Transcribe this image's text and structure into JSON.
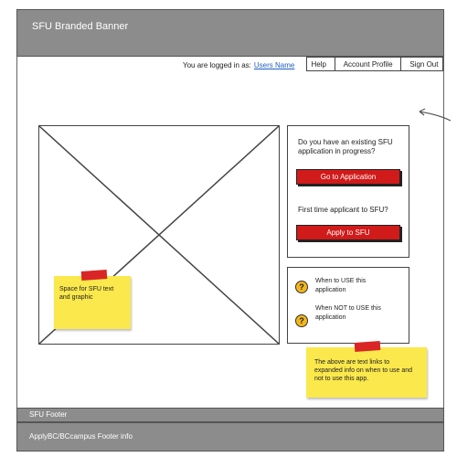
{
  "banner": {
    "title": "SFU Branded Banner"
  },
  "user": {
    "logged_in_label": "You are logged in as:",
    "name": "Users Name"
  },
  "topnav": {
    "items": [
      "Help",
      "Account Profile",
      "Sign Out"
    ]
  },
  "placeholder_note": "Space for SFU text and graphic",
  "existing_app": {
    "question": "Do you have an existing SFU application in progress?",
    "button": "Go to Application"
  },
  "new_app": {
    "question": "First time applicant to SFU?",
    "button": "Apply to SFU"
  },
  "help_links": [
    {
      "icon": "question-icon",
      "text": "When to USE this application"
    },
    {
      "icon": "question-icon",
      "text": "When NOT to USE this application"
    }
  ],
  "help_note": "The above are text links to expanded info on when to use and not to use this app.",
  "footer": {
    "primary": "SFU Footer",
    "secondary": "ApplyBC/BCcampus Footer info"
  },
  "colors": {
    "banner": "#8c8c8c",
    "button_red": "#d11a1a",
    "sticky_note": "#fbe84c",
    "help_icon": "#f2b71c",
    "link": "#1f5fbf"
  }
}
